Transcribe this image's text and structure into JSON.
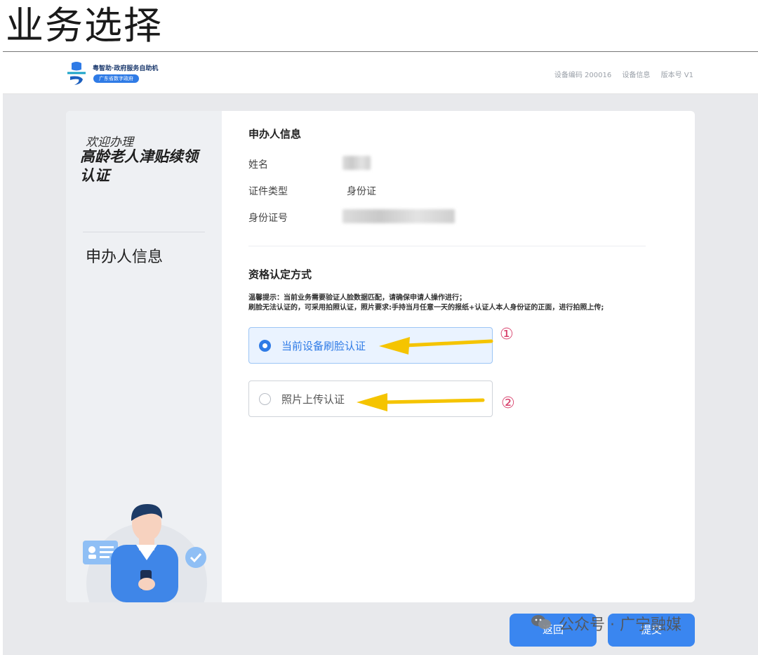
{
  "page_heading": "业务选择",
  "header": {
    "logo_title": "粤智助·政府服务自助机",
    "logo_subtitle": "广东省数字政府",
    "device_code": "设备编码 200016",
    "device_info": "设备信息",
    "version": "版本号 V1"
  },
  "sidebar": {
    "welcome": "欢迎办理",
    "service_name": "高龄老人津贴续领认证",
    "step": "申办人信息"
  },
  "applicant": {
    "section_title": "申办人信息",
    "name_label": "姓名",
    "id_type_label": "证件类型",
    "id_type_value": "身份证",
    "id_number_label": "身份证号"
  },
  "qualification": {
    "section_title": "资格认定方式",
    "notice_line1": "温馨提示：当前业务需要验证人脸数据匹配，请确保申请人操作进行；",
    "notice_line2": "刷脸无法认证的，可采用拍照认证，照片要求:手持当月任意一天的报纸+认证人本人身份证的正面，进行拍照上传;",
    "options": [
      {
        "label": "当前设备刷脸认证",
        "selected": true,
        "marker": "①"
      },
      {
        "label": "照片上传认证",
        "selected": false,
        "marker": "②"
      }
    ]
  },
  "annotations": {
    "arrow_color": "#f5c400",
    "marker_color": "#d8426d"
  },
  "buttons": {
    "back": "返回",
    "submit": "提交"
  },
  "watermark": "公众号 · 广宁融媒",
  "colors": {
    "primary": "#2f7be6",
    "panel": "#eef0f3",
    "background": "#e8e9ec"
  }
}
